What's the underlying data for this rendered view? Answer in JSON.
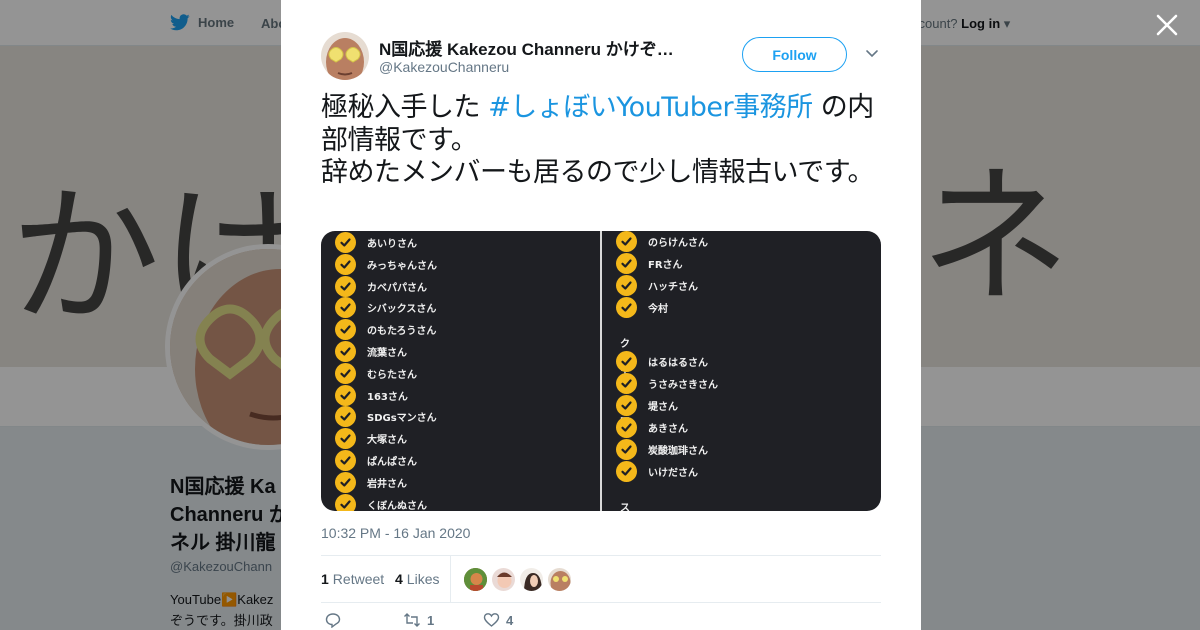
{
  "background": {
    "nav": {
      "home": "Home",
      "about": "Abo",
      "account_prompt": "ccount?",
      "login": "Log in"
    },
    "banner": {
      "left_text": "かけ",
      "right_text": "ネル"
    },
    "profile": {
      "name": "N国応援 Kakezou Channeru かけぞうチャンネル 掛川龍",
      "name_lines": [
        "N国応援 Ka",
        "Channeru か",
        "ネル 掛川龍"
      ],
      "handle": "@KakezouChann",
      "bio_lines": [
        "YouTube▶️Kakez",
        "ぞうです。掛川政"
      ]
    }
  },
  "modal": {
    "author": {
      "name": "N国応援 Kakezou Channeru かけぞ…",
      "handle": "@KakezouChanneru"
    },
    "follow_label": "Follow",
    "tweet": {
      "before_hashtag": "極秘入手した ",
      "hashtag": "#しょぼいYouTuber事務所",
      "after_hashtag": " の内部情報です。",
      "line2": "辞めたメンバーも居るので少し情報古いです。"
    },
    "media": {
      "left_items": [
        "あいりさん",
        "みっちゃんさん",
        "カベパパさん",
        "シバックスさん",
        "のもたろうさん",
        "流葉さん",
        "むらたさん",
        "163さん",
        "SDGsマンさん",
        "大塚さん",
        "ぱんぱさん",
        "岩井さん",
        "くぼんぬさん"
      ],
      "right_items_top": [
        "のらけんさん",
        "FRさん",
        "ハッチさん",
        "今村"
      ],
      "section_creator": "クリエーター",
      "right_items_creator": [
        "はるはるさん",
        "うさみさきさん",
        "堤さん",
        "あきさん",
        "炭酸珈琲さん",
        "いけださん"
      ],
      "section_sponsor": "スポンサー"
    },
    "timestamp": "10:32 PM - 16 Jan 2020",
    "stats": {
      "retweets_count": "1",
      "retweets_label": "Retweet",
      "likes_count": "4",
      "likes_label": "Likes"
    },
    "actions": {
      "retweet_count": "1",
      "like_count": "4"
    }
  },
  "colors": {
    "accent": "#1da1f2",
    "hashtag": "#1b95e0",
    "check": "#f4b81a",
    "media_bg": "#1f2025"
  }
}
